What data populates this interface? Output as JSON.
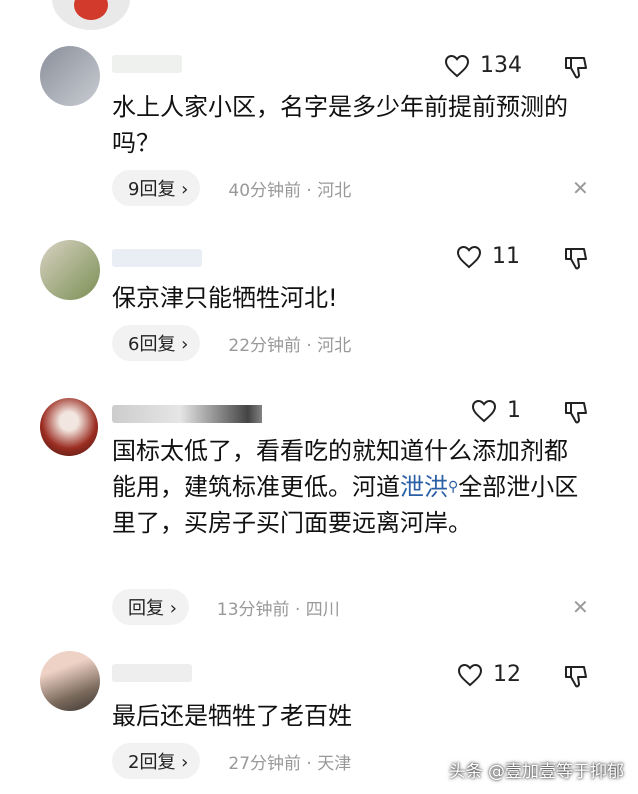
{
  "comments": [
    {
      "likes": "134",
      "text": "水上人家小区，名字是多少年前提前预测的吗？",
      "reply_label": "9回复 ›",
      "time_location": "40分钟前 · 河北"
    },
    {
      "likes": "11",
      "text": "保京津只能牺牲河北!",
      "reply_label": "6回复 ›",
      "time_location": "22分钟前 · 河北"
    },
    {
      "likes": "1",
      "text_before_link": "国标太低了，看看吃的就知道什么添加剂都能用，建筑标准更低。河道",
      "link_text": "泄洪",
      "text_after_link": "全部泄小区里了，买房子买门面要远离河岸。",
      "reply_label": "回复 ›",
      "time_location": "13分钟前 · 四川"
    },
    {
      "likes": "12",
      "text": "最后还是牺牲了老百姓",
      "reply_label": "2回复 ›",
      "time_location": "27分钟前 · 天津"
    }
  ],
  "icons": {
    "like": "heart-outline-icon",
    "dislike": "thumbs-down-outline-icon",
    "close": "close-icon",
    "search_link": "search-icon"
  },
  "watermark": "头条 @壹加壹等于抑郁",
  "colors": {
    "link": "#2b5fa6",
    "meta": "#999999",
    "reply_bg": "#f2f2f2"
  }
}
